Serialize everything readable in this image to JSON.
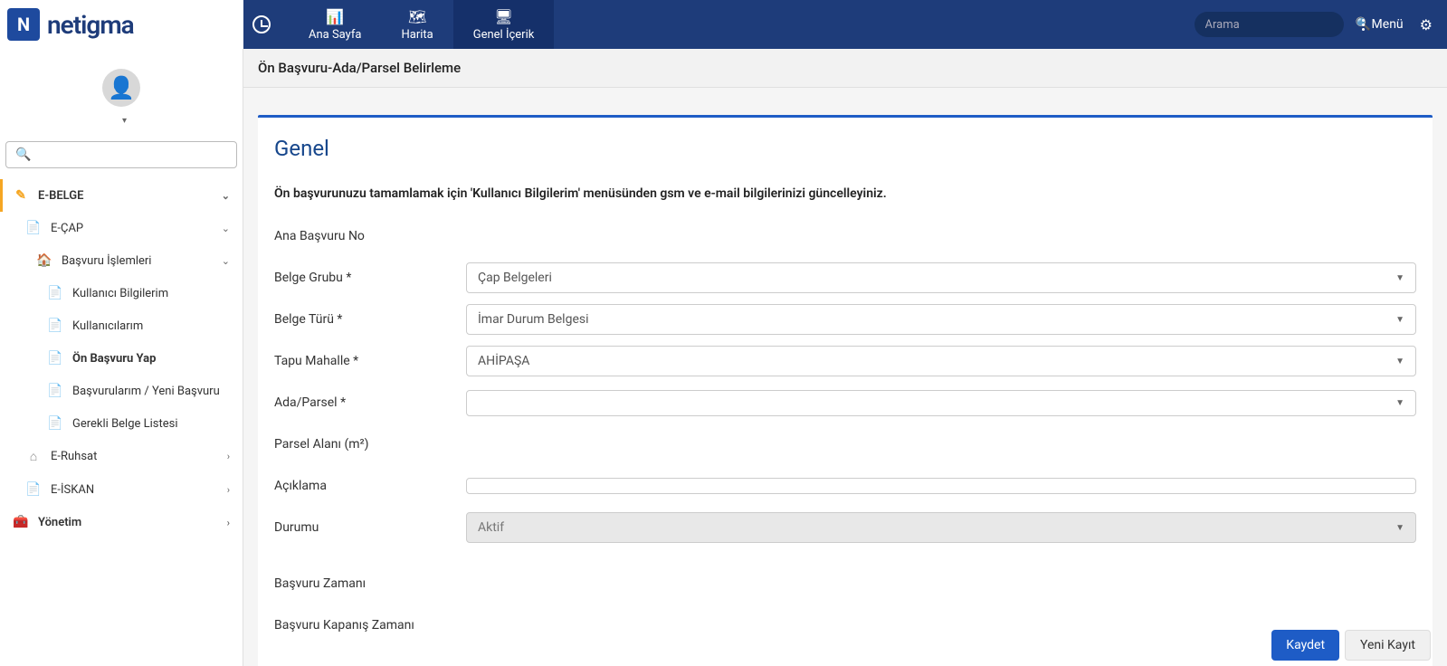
{
  "app": {
    "name": "netigma"
  },
  "topnav": {
    "tabs": [
      {
        "label": "Ana Sayfa",
        "icon": "📊"
      },
      {
        "label": "Harita",
        "icon": "🗺"
      },
      {
        "label": "Genel İçerik",
        "icon": "🖥"
      }
    ],
    "search_placeholder": "Arama",
    "menu_label": "Menü"
  },
  "sidebar": {
    "items": [
      {
        "label": "E-BELGE",
        "level": 0,
        "icon": "✎",
        "iconClass": "ico-edit",
        "expandable": true,
        "open": true,
        "accent": true
      },
      {
        "label": "E-ÇAP",
        "level": 1,
        "icon": "📄",
        "iconClass": "ico-doc",
        "expandable": true,
        "open": true
      },
      {
        "label": "Başvuru İşlemleri",
        "level": 2,
        "icon": "🏠",
        "iconClass": "ico-home",
        "expandable": true,
        "open": true
      },
      {
        "label": "Kullanıcı Bilgilerim",
        "level": 3,
        "icon": "📄",
        "iconClass": "ico-doc"
      },
      {
        "label": "Kullanıcılarım",
        "level": 3,
        "icon": "📄",
        "iconClass": "ico-doc"
      },
      {
        "label": "Ön Başvuru Yap",
        "level": 3,
        "icon": "📄",
        "iconClass": "ico-doc",
        "active": true
      },
      {
        "label": "Başvurularım / Yeni Başvuru",
        "level": 3,
        "icon": "📄",
        "iconClass": "ico-doc"
      },
      {
        "label": "Gerekli Belge Listesi",
        "level": 3,
        "icon": "📄",
        "iconClass": "ico-doc"
      },
      {
        "label": "E-Ruhsat",
        "level": 1,
        "icon": "⌂",
        "iconClass": "ico-build",
        "expandable": true,
        "open": false
      },
      {
        "label": "E-İSKAN",
        "level": 1,
        "icon": "📄",
        "iconClass": "ico-doc",
        "expandable": true,
        "open": false
      },
      {
        "label": "Yönetim",
        "level": 0,
        "icon": "🧰",
        "iconClass": "ico-manage",
        "expandable": true,
        "open": false
      }
    ]
  },
  "breadcrumb": "Ön Başvuru-Ada/Parsel Belirleme",
  "form": {
    "title": "Genel",
    "info": "Ön başvurunuzu tamamlamak için 'Kullanıcı Bilgilerim' menüsünden gsm ve e-mail bilgilerinizi güncelleyiniz.",
    "fields": {
      "ana_basvuru_no": {
        "label": "Ana Başvuru No",
        "value": ""
      },
      "belge_grubu": {
        "label": "Belge Grubu *",
        "value": "Çap Belgeleri"
      },
      "belge_turu": {
        "label": "Belge Türü *",
        "value": "İmar Durum Belgesi"
      },
      "tapu_mahalle": {
        "label": "Tapu Mahalle *",
        "value": "AHİPAŞA"
      },
      "ada_parsel": {
        "label": "Ada/Parsel *",
        "value": ""
      },
      "parsel_alani": {
        "label": "Parsel Alanı (m²)",
        "value": ""
      },
      "aciklama": {
        "label": "Açıklama",
        "value": ""
      },
      "durumu": {
        "label": "Durumu",
        "value": "Aktif"
      },
      "basvuru_zamani": {
        "label": "Başvuru Zamanı",
        "value": ""
      },
      "basvuru_kapanis": {
        "label": "Başvuru Kapanış Zamanı",
        "value": ""
      }
    }
  },
  "actions": {
    "save": "Kaydet",
    "new": "Yeni Kayıt"
  }
}
